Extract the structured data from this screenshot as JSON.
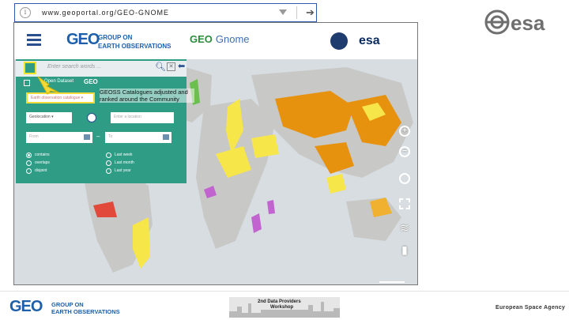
{
  "browser": {
    "url": "www.geoportal.org/GEO-GNOME",
    "info_symbol": "i",
    "go_symbol": "➔"
  },
  "top_logo": {
    "text": "esa"
  },
  "app_header": {
    "geo_mark": "GEO",
    "geo_line1": "GROUP ON",
    "geo_line2": "EARTH OBSERVATIONS",
    "title_mark": "GEO",
    "title": "Gnome",
    "partner_logo": "esa"
  },
  "search_panel": {
    "placeholder": "Enter search words ...",
    "data_option": "Open Dataset",
    "geo_mark": "GEO",
    "catalogue_select": "Earth observation catalogue ▾",
    "callout": "GEOSS Catalogues adjusted and ranked around the Community",
    "geo_select": "Geolocation ▾",
    "location_placeholder": "Enter a location",
    "from_placeholder": "From",
    "dash": "–",
    "to_placeholder": "To",
    "radios_left": [
      {
        "label": "contains",
        "checked": true
      },
      {
        "label": "overlaps",
        "checked": false
      },
      {
        "label": "disjoint",
        "checked": false
      }
    ],
    "radios_right": [
      {
        "label": "Last week",
        "checked": false
      },
      {
        "label": "Last month",
        "checked": false
      },
      {
        "label": "Last year",
        "checked": false
      }
    ]
  },
  "map_tools": [
    "zoom-in",
    "zoom-out",
    "navigation",
    "extent",
    "layers",
    "bookmark"
  ],
  "footer": {
    "geo_mark": "GEO",
    "geo_line1": "GROUP ON",
    "geo_line2": "EARTH OBSERVATIONS",
    "workshop_line1": "2nd Data Providers",
    "workshop_line2": "Workshop",
    "agency": "European Space Agency"
  },
  "colors": {
    "panel": "#2f9c86",
    "highlight": "#f2d93c",
    "accent_blue": "#1d5fa8",
    "map_land": "#d7dde0",
    "land_orange": "#e6920f",
    "land_yellow": "#f7e64a",
    "land_magenta": "#c264d0",
    "land_red": "#e14a3a",
    "land_green": "#6bbf4e"
  }
}
